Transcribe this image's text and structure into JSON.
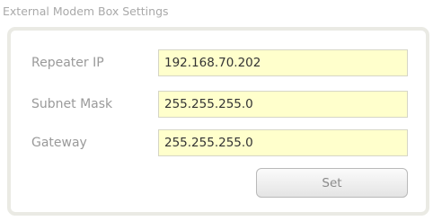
{
  "section": {
    "title": "External Modem Box Settings"
  },
  "form": {
    "repeater_ip": {
      "label": "Repeater IP",
      "value": "192.168.70.202"
    },
    "subnet_mask": {
      "label": "Subnet Mask",
      "value": "255.255.255.0"
    },
    "gateway": {
      "label": "Gateway",
      "value": "255.255.255.0"
    },
    "set_label": "Set"
  },
  "colors": {
    "field_background": "#ffffcc",
    "label_text": "#9a9a9a",
    "panel_border": "#eaeae4"
  }
}
